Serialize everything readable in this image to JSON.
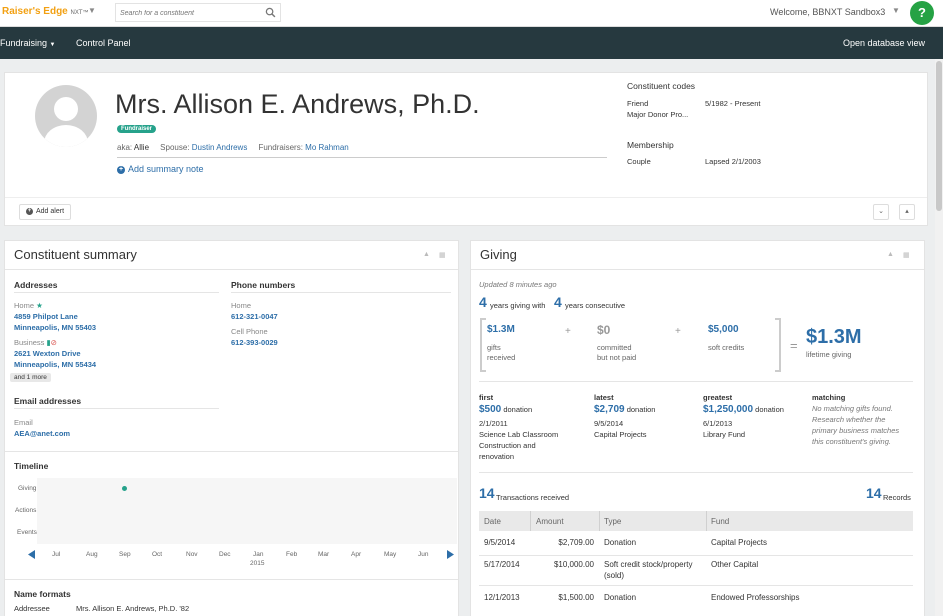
{
  "topbar": {
    "logo": "Raiser's Edge",
    "logo_suffix": "NXT™",
    "search_placeholder": "Search for a constituent",
    "welcome": "Welcome, BBNXT Sandbox3",
    "help": "?"
  },
  "nav": {
    "fundraising": "Fundraising",
    "control_panel": "Control Panel",
    "open_db_view": "Open database view"
  },
  "header": {
    "name": "Mrs. Allison E. Andrews, Ph.D.",
    "badge": "Fundraiser",
    "aka_label": "aka:",
    "aka_value": "Allie",
    "spouse_label": "Spouse:",
    "spouse_value": "Dustin Andrews",
    "fundraisers_label": "Fundraisers:",
    "fundraisers_value": "Mo Rahman",
    "add_summary_note": "Add summary note",
    "add_alert": "Add alert",
    "codes_title": "Constituent codes",
    "codes": [
      {
        "label": "Friend",
        "value": "5/1982 - Present"
      },
      {
        "label": "Major Donor Pro...",
        "value": ""
      }
    ],
    "membership_title": "Membership",
    "membership": [
      {
        "label": "Couple",
        "value": "Lapsed 2/1/2003"
      }
    ]
  },
  "summary": {
    "title": "Constituent summary",
    "addresses_title": "Addresses",
    "home_label": "Home",
    "home_line1": "4859 Philpot Lane",
    "home_line2": "Minneapolis, MN 55403",
    "business_label": "Business",
    "business_line1": "2621 Wexton Drive",
    "business_line2": "Minneapolis, MN 55434",
    "and_more": "and 1 more",
    "phone_title": "Phone numbers",
    "phone_home_label": "Home",
    "phone_home": "612-321-0047",
    "phone_cell_label": "Cell Phone",
    "phone_cell": "612-393-0029",
    "email_title": "Email addresses",
    "email_label": "Email",
    "email": "AEA@anet.com",
    "timeline_title": "Timeline",
    "timeline_rows": [
      "Giving",
      "Actions",
      "Events"
    ],
    "timeline_months": [
      "Jul",
      "Aug",
      "Sep",
      "Oct",
      "Nov",
      "Dec",
      "Jan",
      "Feb",
      "Mar",
      "Apr",
      "May",
      "Jun"
    ],
    "timeline_year": "2015",
    "name_formats_title": "Name formats",
    "addressee_label": "Addressee",
    "addressee_value": "Mrs. Allison E. Andrews, Ph.D. '82"
  },
  "giving": {
    "title": "Giving",
    "updated": "Updated 8 minutes ago",
    "years_giving": "4",
    "years_giving_text": "years giving with",
    "years_consecutive": "4",
    "years_consecutive_text": "years consecutive",
    "gifts_received": "$1.3M",
    "gifts_received_label_1": "gifts",
    "gifts_received_label_2": "received",
    "committed": "$0",
    "committed_label_1": "committed",
    "committed_label_2": "but not paid",
    "soft_credits": "$5,000",
    "soft_credits_label": "soft credits",
    "lifetime": "$1.3M",
    "lifetime_label": "lifetime giving",
    "op_plus": "+",
    "op_equals": "=",
    "first_title": "first",
    "first_amount": "$500",
    "first_word": "donation",
    "first_date": "2/1/2011",
    "first_fund_1": "Science Lab Classroom",
    "first_fund_2": "Construction and",
    "first_fund_3": "renovation",
    "latest_title": "latest",
    "latest_amount": "$2,709",
    "latest_word": "donation",
    "latest_date": "9/5/2014",
    "latest_fund": "Capital Projects",
    "greatest_title": "greatest",
    "greatest_amount": "$1,250,000",
    "greatest_word": "donation",
    "greatest_date": "6/1/2013",
    "greatest_fund": "Library Fund",
    "matching_title": "matching",
    "matching_text_1": "No matching gifts found.",
    "matching_text_2": "Research whether the",
    "matching_text_3": "primary business matches",
    "matching_text_4": "this constituent's giving.",
    "transactions_count": "14",
    "transactions_text": "Transactions received",
    "records_count": "14",
    "records_text": "Records",
    "table_headers": [
      "Date",
      "Amount",
      "Type",
      "Fund"
    ],
    "rows": [
      {
        "date": "9/5/2014",
        "amount": "$2,709.00",
        "type": "Donation",
        "type2": "",
        "fund": "Capital Projects"
      },
      {
        "date": "5/17/2014",
        "amount": "$10,000.00",
        "type": "Soft credit stock/property",
        "type2": "(sold)",
        "fund": "Other Capital"
      },
      {
        "date": "12/1/2013",
        "amount": "$1,500.00",
        "type": "Donation",
        "type2": "",
        "fund": "Endowed Professorships"
      }
    ]
  },
  "colors": {
    "nav": "#26393f",
    "accent": "#2d6ea8",
    "badge": "#26a28b",
    "logo": "#f2a012",
    "help": "#25a244"
  }
}
